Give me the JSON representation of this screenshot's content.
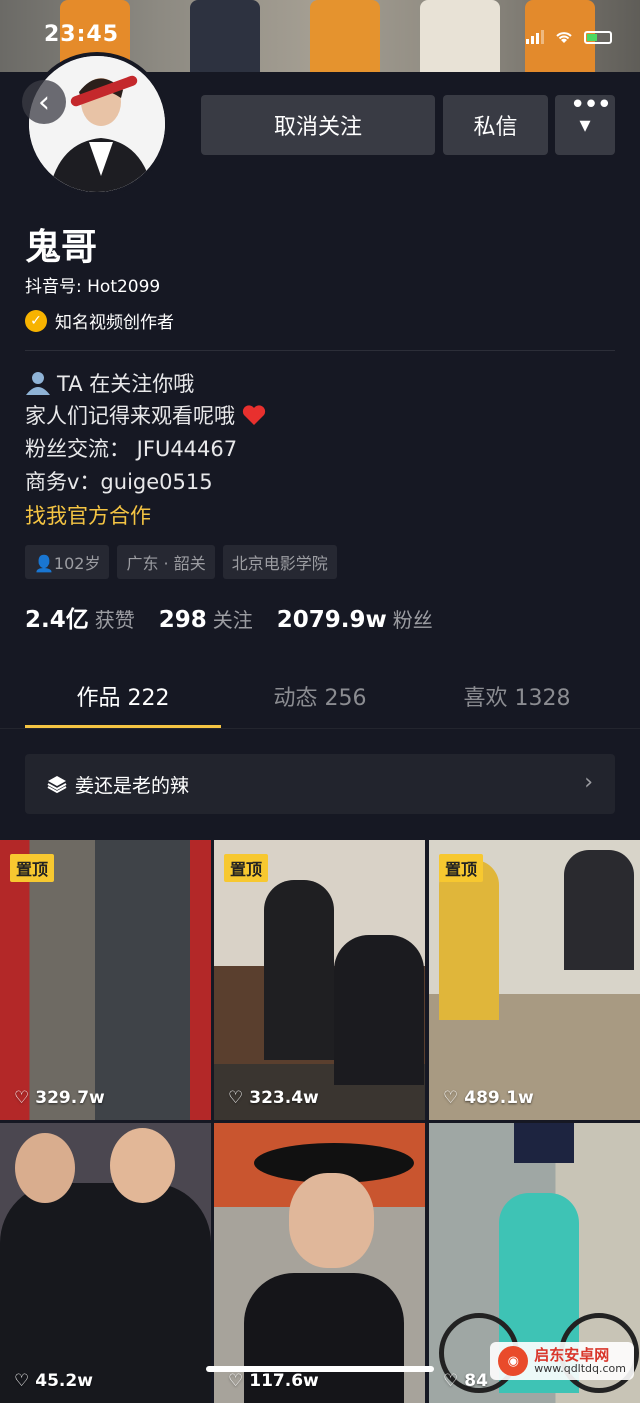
{
  "status_bar": {
    "time": "23:45"
  },
  "profile": {
    "name": "鬼哥",
    "douyin_id": "抖音号: Hot2099",
    "verified_label": "知名视频创作者"
  },
  "actions": {
    "unfollow": "取消关注",
    "message": "私信",
    "more_dropdown": "▾",
    "more_dots": "•••",
    "back": "‹"
  },
  "bio": {
    "line1": "TA 在关注你哦",
    "line2": "家人们记得来观看呢哦",
    "line3": "粉丝交流： JFU44467",
    "line4": "商务v：guige0515",
    "link": "找我官方合作"
  },
  "tags": [
    "102岁",
    "广东 · 韶关",
    "北京电影学院"
  ],
  "stats": {
    "likes_value": "2.4亿",
    "likes_label": "获赞",
    "following_value": "298",
    "following_label": "关注",
    "followers_value": "2079.9w",
    "followers_label": "粉丝"
  },
  "tabs": {
    "works": "作品 222",
    "dynamic": "动态 256",
    "favorites": "喜欢 1328"
  },
  "collection": {
    "label": "姜还是老的辣"
  },
  "videos": [
    {
      "pinned": "置顶",
      "likes": "329.7w",
      "color": "#6e6a63"
    },
    {
      "pinned": "置顶",
      "likes": "323.4w",
      "color": "#8a7a68"
    },
    {
      "pinned": "置顶",
      "likes": "489.1w",
      "color": "#a29786"
    },
    {
      "pinned": "",
      "likes": "45.2w",
      "color": "#4b4750"
    },
    {
      "pinned": "",
      "likes": "117.6w",
      "color": "#8c5a3e"
    },
    {
      "pinned": "",
      "likes": "84",
      "color": "#9fa7a4"
    }
  ],
  "watermark": {
    "title": "启东安卓网",
    "url": "www.qdltdq.com"
  }
}
